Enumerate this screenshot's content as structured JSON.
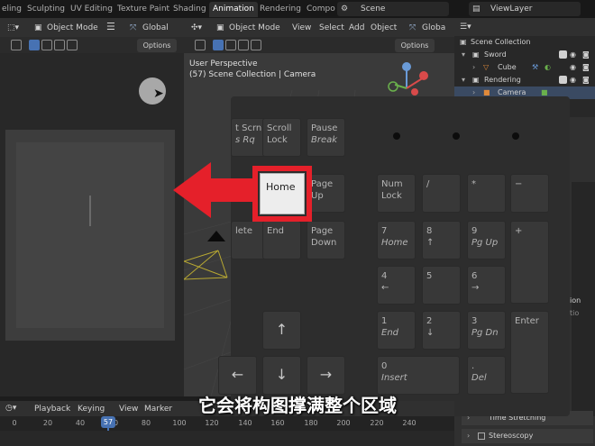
{
  "workspace_tabs": [
    "eling",
    "Sculpting",
    "UV Editing",
    "Texture Paint",
    "Shading",
    "Animation",
    "Rendering",
    "Compo"
  ],
  "active_tab": "Animation",
  "scene_name": "Scene",
  "view_layer": "ViewLayer",
  "left_header": {
    "mode": "Object Mode",
    "orientation": "Global",
    "options": "Options"
  },
  "viewport": {
    "mode": "Object Mode",
    "menus": [
      "View",
      "Select",
      "Add",
      "Object"
    ],
    "orientation": "Globa",
    "options": "Options",
    "info_line1": "User Perspective",
    "info_line2": "(57) Scene Collection | Camera"
  },
  "outliner": {
    "root": "Scene Collection",
    "items": [
      {
        "label": "Sword",
        "indent": 1
      },
      {
        "label": "Cube",
        "indent": 2
      },
      {
        "label": "Rendering",
        "indent": 1
      },
      {
        "label": "Camera",
        "indent": 2
      }
    ]
  },
  "properties": {
    "sections": [
      "Time Stretching",
      "Stereoscopy"
    ],
    "partial_labels": [
      "ion",
      "tio"
    ]
  },
  "keyboard": {
    "keys": [
      {
        "l1": "t Scrn",
        "l2": "s Rq"
      },
      {
        "l1": "Scroll",
        "l2": "Lock",
        "plain2": true
      },
      {
        "l1": "Pause",
        "l2": "Break"
      },
      {
        "l1": "Page",
        "l2": "Up",
        "plain2": true
      },
      {
        "l1": "lete",
        "l2": ""
      },
      {
        "l1": "End",
        "l2": ""
      },
      {
        "l1": "Page",
        "l2": "Down",
        "plain2": true
      },
      {
        "l1": "Num",
        "l2": "Lock",
        "plain2": true
      },
      {
        "l1": "/",
        "l2": ""
      },
      {
        "l1": "*",
        "l2": ""
      },
      {
        "l1": "−",
        "l2": ""
      },
      {
        "l1": "7",
        "l2": "Home"
      },
      {
        "l1": "8",
        "l2": "↑"
      },
      {
        "l1": "9",
        "l2": "Pg Up"
      },
      {
        "l1": "+",
        "l2": ""
      },
      {
        "l1": "4",
        "l2": "←"
      },
      {
        "l1": "5",
        "l2": ""
      },
      {
        "l1": "6",
        "l2": "→"
      },
      {
        "l1": "1",
        "l2": "End"
      },
      {
        "l1": "2",
        "l2": "↓"
      },
      {
        "l1": "3",
        "l2": "Pg Dn"
      },
      {
        "l1": "Enter",
        "l2": ""
      },
      {
        "l1": "0",
        "l2": "Insert"
      },
      {
        "l1": ".",
        "l2": "Del"
      }
    ],
    "arrows": [
      "↑",
      "←",
      "↓",
      "→"
    ],
    "highlighted_key": "Home",
    "highlight_color": "#e5202a"
  },
  "subtitle": "它会将构图撑满整个区域",
  "timeline": {
    "menus": [
      "Playback",
      "Keying",
      "View",
      "Marker"
    ],
    "ticks": [
      "0",
      "20",
      "40",
      "60",
      "80",
      "100",
      "120",
      "140",
      "160",
      "180",
      "200",
      "220",
      "240"
    ],
    "current_frame": "57"
  },
  "colors": {
    "accent_blue": "#4772b3",
    "red_arrow": "#e5202a"
  }
}
